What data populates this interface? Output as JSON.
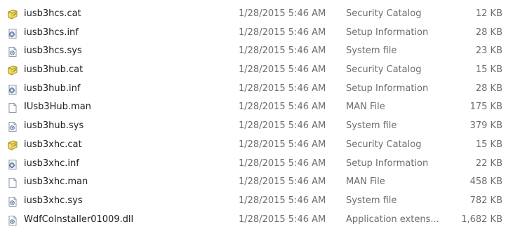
{
  "files": [
    {
      "name": "iusb3hcs.cat",
      "date": "1/28/2015 5:46 AM",
      "type": "Security Catalog",
      "size": "12 KB",
      "icon": "security-catalog-icon"
    },
    {
      "name": "iusb3hcs.inf",
      "date": "1/28/2015 5:46 AM",
      "type": "Setup Information",
      "size": "28 KB",
      "icon": "setup-information-icon"
    },
    {
      "name": "iusb3hcs.sys",
      "date": "1/28/2015 5:46 AM",
      "type": "System file",
      "size": "23 KB",
      "icon": "system-file-icon"
    },
    {
      "name": "iusb3hub.cat",
      "date": "1/28/2015 5:46 AM",
      "type": "Security Catalog",
      "size": "15 KB",
      "icon": "security-catalog-icon"
    },
    {
      "name": "iusb3hub.inf",
      "date": "1/28/2015 5:46 AM",
      "type": "Setup Information",
      "size": "28 KB",
      "icon": "setup-information-icon"
    },
    {
      "name": "IUsb3Hub.man",
      "date": "1/28/2015 5:46 AM",
      "type": "MAN File",
      "size": "175 KB",
      "icon": "blank-file-icon"
    },
    {
      "name": "iusb3hub.sys",
      "date": "1/28/2015 5:46 AM",
      "type": "System file",
      "size": "379 KB",
      "icon": "system-file-icon"
    },
    {
      "name": "iusb3xhc.cat",
      "date": "1/28/2015 5:46 AM",
      "type": "Security Catalog",
      "size": "15 KB",
      "icon": "security-catalog-icon"
    },
    {
      "name": "iusb3xhc.inf",
      "date": "1/28/2015 5:46 AM",
      "type": "Setup Information",
      "size": "22 KB",
      "icon": "setup-information-icon"
    },
    {
      "name": "iusb3xhc.man",
      "date": "1/28/2015 5:46 AM",
      "type": "MAN File",
      "size": "458 KB",
      "icon": "blank-file-icon"
    },
    {
      "name": "iusb3xhc.sys",
      "date": "1/28/2015 5:46 AM",
      "type": "System file",
      "size": "782 KB",
      "icon": "system-file-icon"
    },
    {
      "name": "WdfCoInstaller01009.dll",
      "date": "1/28/2015 5:46 AM",
      "type": "Application extens...",
      "size": "1,682 KB",
      "icon": "system-file-icon"
    }
  ]
}
